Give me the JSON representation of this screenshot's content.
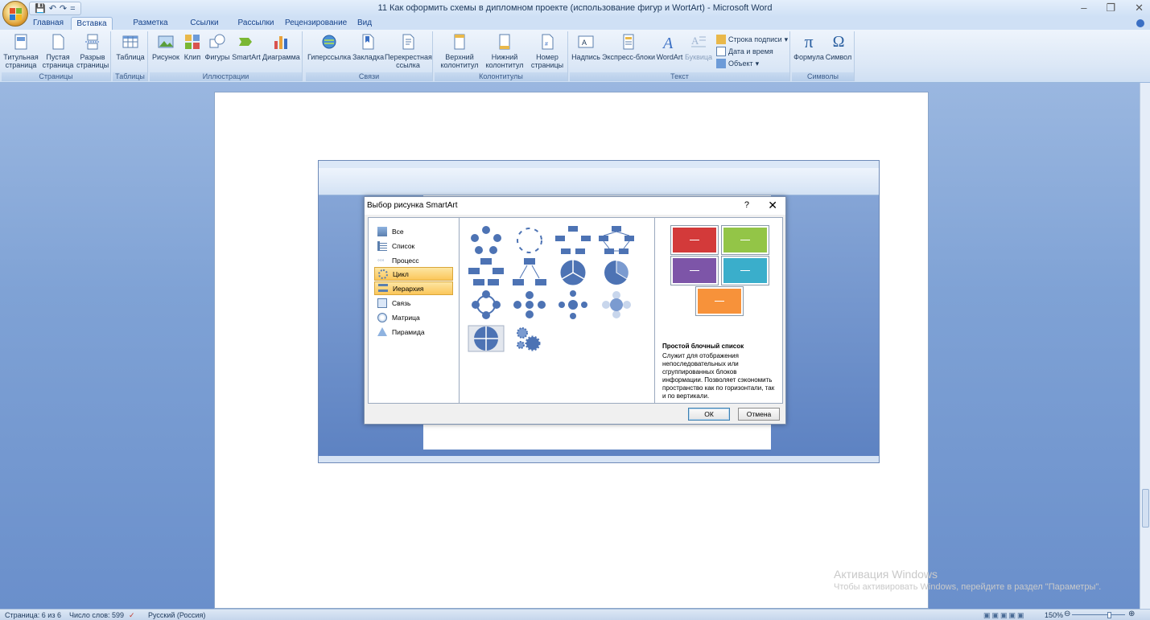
{
  "window": {
    "title": "11 Как оформить схемы в дипломном проекте (использование фигур и WortArt) - Microsoft Word",
    "qat_more": "="
  },
  "tabs": [
    "Главная",
    "Вставка",
    "Разметка страницы",
    "Ссылки",
    "Рассылки",
    "Рецензирование",
    "Вид"
  ],
  "active_tab": "Вставка",
  "ribbon": {
    "pages": {
      "label": "Страницы",
      "title_page": "Титульная страница",
      "blank_page": "Пустая страница",
      "page_break": "Разрыв страницы"
    },
    "tables": {
      "label": "Таблицы",
      "table": "Таблица"
    },
    "illustrations": {
      "label": "Иллюстрации",
      "picture": "Рисунок",
      "clip": "Клип",
      "shapes": "Фигуры",
      "smartart": "SmartArt",
      "chart": "Диаграмма"
    },
    "links": {
      "label": "Связи",
      "hyperlink": "Гиперссылка",
      "bookmark": "Закладка",
      "crossref": "Перекрестная ссылка"
    },
    "headers": {
      "label": "Колонтитулы",
      "header": "Верхний колонтитул",
      "footer": "Нижний колонтитул",
      "page_number": "Номер страницы"
    },
    "text": {
      "label": "Текст",
      "textbox": "Надпись",
      "quickparts": "Экспресс-блоки",
      "wordart": "WordArt",
      "dropcap": "Буквица",
      "signature": "Строка подписи",
      "datetime": "Дата и время",
      "object": "Объект"
    },
    "symbols": {
      "label": "Символы",
      "equation": "Формула",
      "symbol": "Символ"
    }
  },
  "dialog": {
    "title": "Выбор рисунка SmartArt",
    "help": "?",
    "close": "✕",
    "categories": [
      {
        "label": "Все",
        "selected": false
      },
      {
        "label": "Список",
        "selected": false
      },
      {
        "label": "Процесс",
        "selected": false
      },
      {
        "label": "Цикл",
        "selected": true
      },
      {
        "label": "Иерархия",
        "selected": true
      },
      {
        "label": "Связь",
        "selected": false
      },
      {
        "label": "Матрица",
        "selected": false
      },
      {
        "label": "Пирамида",
        "selected": false
      }
    ],
    "preview_title": "Простой блочный список",
    "preview_description": "Служит для отображения непоследовательных или сгруппированных блоков информации. Позволяет сэкономить пространство как по горизонтали, так и по вертикали.",
    "preview_colors": [
      "#d33a3a",
      "#93c547",
      "#7d55a8",
      "#3aaecb",
      "#f7923a"
    ],
    "ok": "ОК",
    "cancel": "Отмена"
  },
  "watermark": {
    "line1": "Активация Windows",
    "line2": "Чтобы активировать Windows, перейдите в раздел \"Параметры\"."
  },
  "status": {
    "page": "Страница: 6 из 6",
    "words": "Число слов: 599",
    "language": "Русский (Россия)",
    "zoom": "150%"
  }
}
